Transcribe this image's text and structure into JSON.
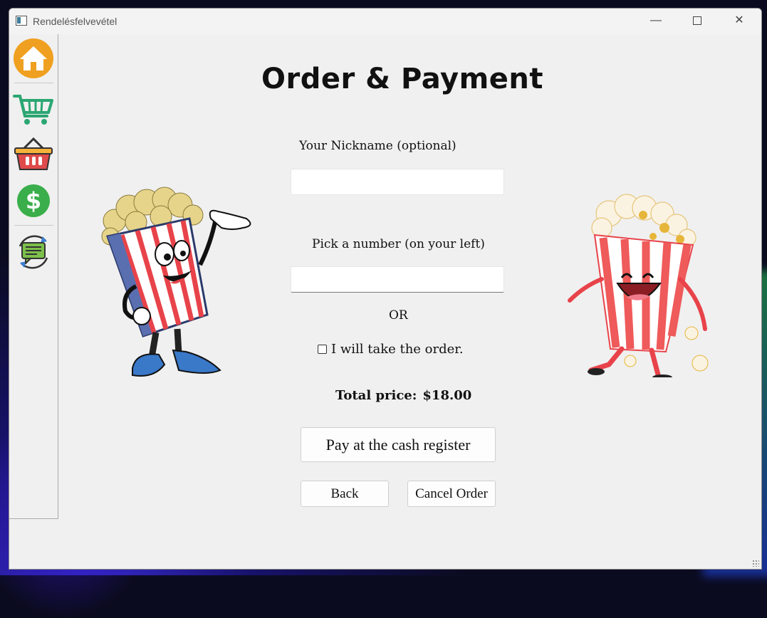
{
  "window": {
    "title": "Rendelésfelvevétel",
    "minimize_symbol": "—",
    "close_symbol": "✕"
  },
  "sidebar": {
    "items": [
      {
        "icon": "home-icon",
        "color": "#f0a020"
      },
      {
        "icon": "shopping-cart-icon",
        "color": "#2ba672"
      },
      {
        "icon": "basket-icon",
        "color": "#e04a4a"
      },
      {
        "icon": "dollar-icon",
        "color": "#3aae4a"
      },
      {
        "icon": "chat-refresh-icon",
        "color": "#7cbf4a"
      }
    ]
  },
  "main": {
    "title": "Order & Payment",
    "nickname_label": "Your Nickname (optional)",
    "nickname_value": "",
    "number_label": "Pick a number (on your left)",
    "number_value": "",
    "or_text": "OR",
    "take_order_label": "I will take the order.",
    "take_order_checked": false,
    "total_label": "Total price:",
    "total_value": "$18.00",
    "pay_button": "Pay at the cash register",
    "back_button": "Back",
    "cancel_button": "Cancel Order"
  },
  "colors": {
    "accent": "#e8434a",
    "window_bg": "#f0f0f0"
  }
}
